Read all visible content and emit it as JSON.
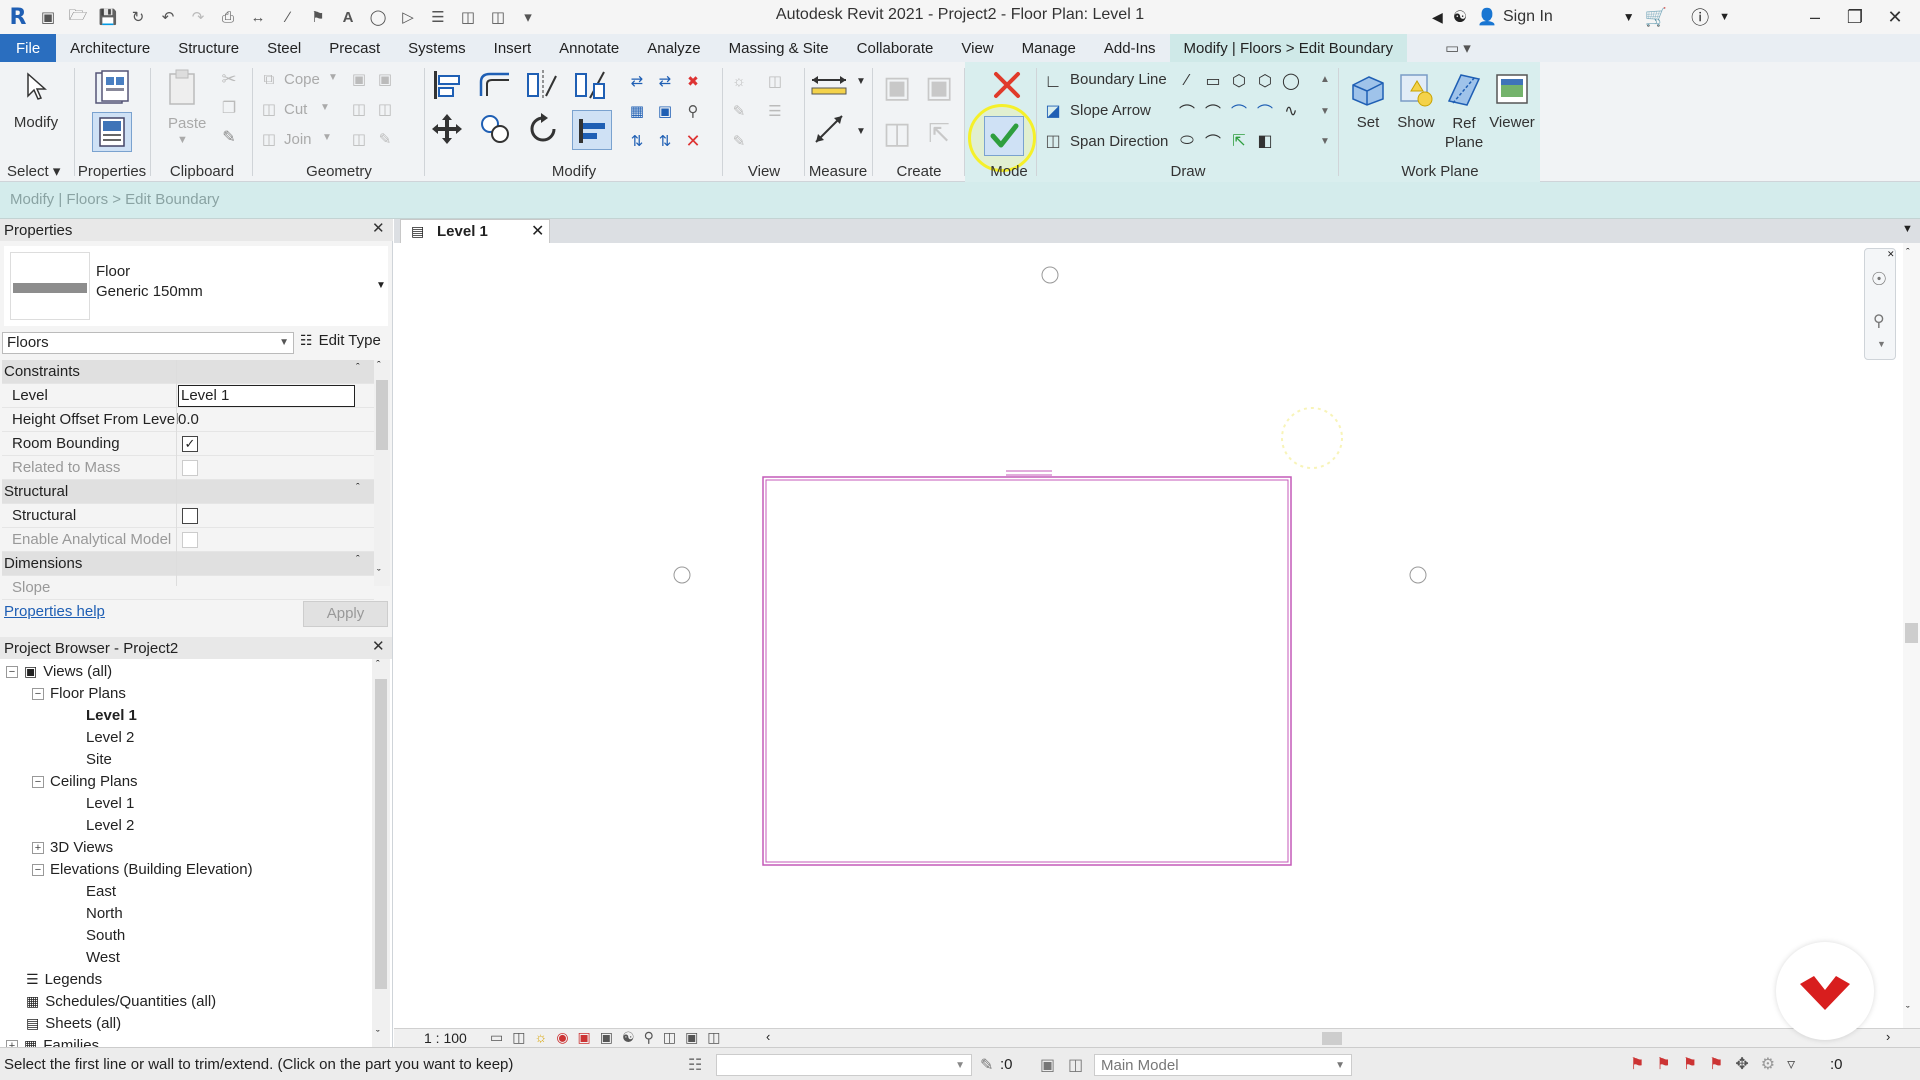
{
  "window": {
    "title": "Autodesk Revit 2021 - Project2 - Floor Plan: Level 1",
    "sign_in": "Sign In"
  },
  "tabs": [
    "File",
    "Architecture",
    "Structure",
    "Steel",
    "Precast",
    "Systems",
    "Insert",
    "Annotate",
    "Analyze",
    "Massing & Site",
    "Collaborate",
    "View",
    "Manage",
    "Add-Ins",
    "Modify | Floors > Edit Boundary"
  ],
  "ribbon": {
    "panels": {
      "select": "Select",
      "properties": "Properties",
      "clipboard": "Clipboard",
      "geometry": "Geometry",
      "modify": "Modify",
      "view": "View",
      "measure": "Measure",
      "create": "Create",
      "mode": "Mode",
      "draw": "Draw",
      "work_plane": "Work Plane"
    },
    "modify_btn": "Modify",
    "paste_btn": "Paste",
    "cope": "Cope",
    "cut": "Cut",
    "join": "Join",
    "boundary_line": "Boundary Line",
    "slope_arrow": "Slope Arrow",
    "span_direction": "Span Direction",
    "set": "Set",
    "show": "Show",
    "ref": "Ref",
    "plane": "Plane",
    "viewer": "Viewer"
  },
  "options_bar": "Modify | Floors > Edit Boundary",
  "properties": {
    "header": "Properties",
    "type_family": "Floor",
    "type_name": "Generic 150mm",
    "category": "Floors",
    "edit_type": "Edit Type",
    "sections": {
      "constraints": "Constraints",
      "structural": "Structural",
      "dimensions": "Dimensions"
    },
    "rows": {
      "level_k": "Level",
      "level_v": "Level 1",
      "offset_k": "Height Offset From Level",
      "offset_v": "0.0",
      "room_k": "Room Bounding",
      "mass_k": "Related to Mass",
      "struct_k": "Structural",
      "analytical_k": "Enable Analytical Model",
      "slope_k": "Slope"
    },
    "help": "Properties help",
    "apply": "Apply"
  },
  "browser": {
    "header": "Project Browser - Project2",
    "items": {
      "views": "Views (all)",
      "floor_plans": "Floor Plans",
      "fp_level1": "Level 1",
      "fp_level2": "Level 2",
      "fp_site": "Site",
      "ceiling_plans": "Ceiling Plans",
      "cp_level1": "Level 1",
      "cp_level2": "Level 2",
      "views3d": "3D Views",
      "elevations": "Elevations (Building Elevation)",
      "east": "East",
      "north": "North",
      "south": "South",
      "west": "West",
      "legends": "Legends",
      "schedules": "Schedules/Quantities (all)",
      "sheets": "Sheets (all)",
      "families": "Families"
    }
  },
  "view_tab": "Level 1",
  "view_scale": "1 : 100",
  "status": {
    "message": "Select the first line or wall to trim/extend.  (Click on the part you want to keep)",
    "workset": ":0",
    "model": "Main Model",
    "filter": ":0"
  },
  "colors": {
    "file_tab": "#2a6ebf",
    "context_tab": "#cfe9e8",
    "sketch_line": "#c45ab8",
    "finish_edit": "#2e9e3e",
    "cancel_edit": "#e03a2a",
    "highlight": "#f5f02a"
  }
}
